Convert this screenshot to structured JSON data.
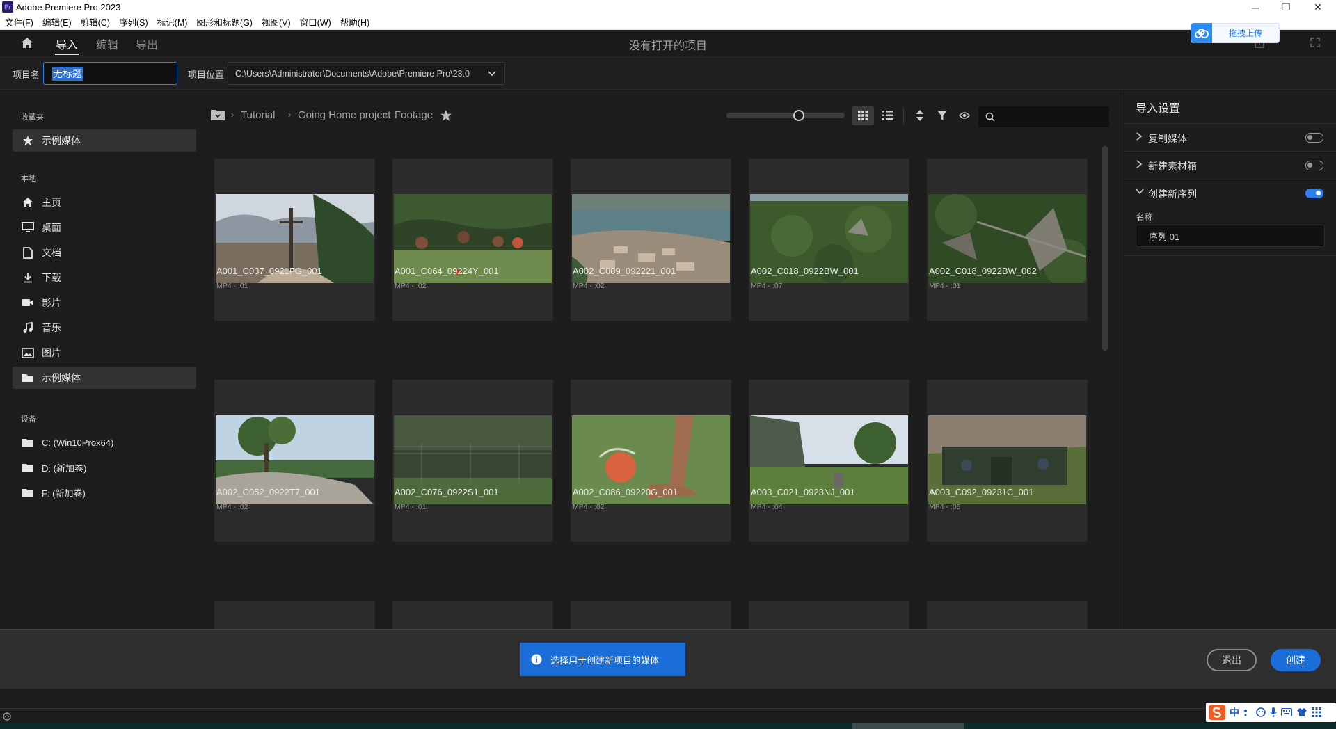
{
  "window": {
    "app_icon_text": "Pr",
    "title": "Adobe Premiere Pro 2023",
    "minimize": "─",
    "restore": "❐",
    "close": "✕"
  },
  "menu": [
    "文件(F)",
    "编辑(E)",
    "剪辑(C)",
    "序列(S)",
    "标记(M)",
    "图形和标题(G)",
    "视图(V)",
    "窗口(W)",
    "帮助(H)"
  ],
  "header": {
    "tabs": [
      "导入",
      "编辑",
      "导出"
    ],
    "active_tab": "导入",
    "title": "没有打开的项目",
    "upload_button": "拖拽上传"
  },
  "project": {
    "name_label": "项目名",
    "name_value": "无标题",
    "location_label": "项目位置",
    "location_value": "C:\\Users\\Administrator\\Documents\\Adobe\\Premiere Pro\\23.0"
  },
  "sidebar": {
    "favorites_header": "收藏夹",
    "favorites": [
      {
        "label": "示例媒体",
        "icon": "star-icon"
      }
    ],
    "local_header": "本地",
    "local": [
      {
        "label": "主页",
        "icon": "home-icon"
      },
      {
        "label": "桌面",
        "icon": "monitor-icon"
      },
      {
        "label": "文档",
        "icon": "document-icon"
      },
      {
        "label": "下载",
        "icon": "download-icon"
      },
      {
        "label": "影片",
        "icon": "video-camera-icon"
      },
      {
        "label": "音乐",
        "icon": "music-note-icon"
      },
      {
        "label": "图片",
        "icon": "image-icon"
      },
      {
        "label": "示例媒体",
        "icon": "folder-icon",
        "selected": true
      }
    ],
    "devices_header": "设备",
    "devices": [
      {
        "label": "C: (Win10Prox64)",
        "icon": "folder-icon"
      },
      {
        "label": "D: (新加卷)",
        "icon": "folder-icon"
      },
      {
        "label": "F: (新加卷)",
        "icon": "folder-icon"
      }
    ]
  },
  "breadcrumb": [
    "Tutorial",
    "Going Home project",
    "Footage"
  ],
  "clips": [
    {
      "name": "A001_C037_0921FG_001",
      "meta": "MP4 - :01"
    },
    {
      "name": "A001_C064_09224Y_001",
      "meta": "MP4 - :02"
    },
    {
      "name": "A002_C009_092221_001",
      "meta": "MP4 - :02"
    },
    {
      "name": "A002_C018_0922BW_001",
      "meta": "MP4 - :07"
    },
    {
      "name": "A002_C018_0922BW_002",
      "meta": "MP4 - :01"
    },
    {
      "name": "A002_C052_0922T7_001",
      "meta": "MP4 - :02"
    },
    {
      "name": "A002_C076_0922S1_001",
      "meta": "MP4 - :01"
    },
    {
      "name": "A002_C086_09220G_001",
      "meta": "MP4 - :02"
    },
    {
      "name": "A003_C021_0923NJ_001",
      "meta": "MP4 - :04"
    },
    {
      "name": "A003_C092_09231C_001",
      "meta": "MP4 - :05"
    }
  ],
  "import_settings": {
    "title": "导入设置",
    "rows": [
      {
        "label": "复制媒体",
        "enabled": false,
        "expanded": false
      },
      {
        "label": "新建素材箱",
        "enabled": false,
        "expanded": false
      },
      {
        "label": "创建新序列",
        "enabled": true,
        "expanded": true
      }
    ],
    "sequence_name_label": "名称",
    "sequence_name_value": "序列 01"
  },
  "footer": {
    "info_message": "选择用于创建新项目的媒体",
    "exit_button": "退出",
    "create_button": "创建"
  },
  "ime": {
    "label": "中"
  },
  "colors": {
    "accent": "#1b6ed8",
    "background": "#1d1d1d",
    "card": "#2b2b2b"
  }
}
